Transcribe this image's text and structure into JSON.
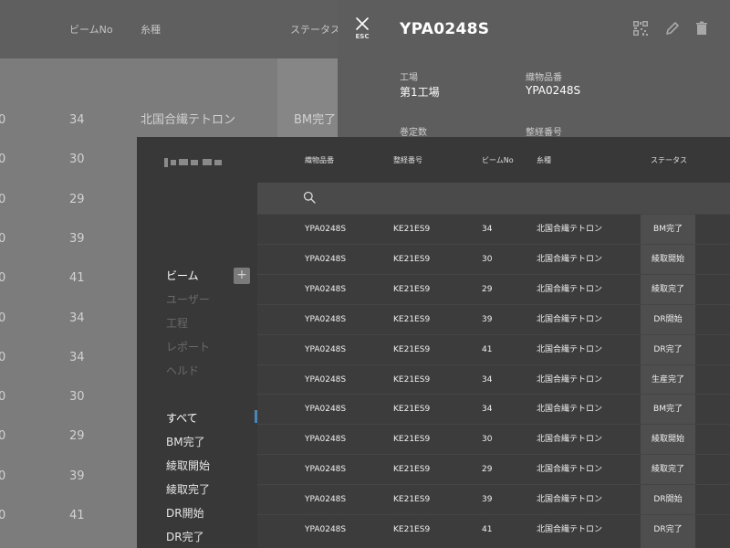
{
  "background_table": {
    "columns": [
      "ビームNo",
      "糸種",
      "ステータス"
    ],
    "rows": [
      {
        "lead": "0",
        "beam": "34",
        "yarn": "北国合繊テトロン",
        "status": "BM完了"
      },
      {
        "lead": "0",
        "beam": "30",
        "yarn": "",
        "status": ""
      },
      {
        "lead": "0",
        "beam": "29",
        "yarn": "",
        "status": ""
      },
      {
        "lead": "0",
        "beam": "39",
        "yarn": "",
        "status": ""
      },
      {
        "lead": "0",
        "beam": "41",
        "yarn": "",
        "status": ""
      },
      {
        "lead": "0",
        "beam": "34",
        "yarn": "",
        "status": ""
      },
      {
        "lead": "0",
        "beam": "34",
        "yarn": "",
        "status": ""
      },
      {
        "lead": "0",
        "beam": "30",
        "yarn": "",
        "status": ""
      },
      {
        "lead": "0",
        "beam": "29",
        "yarn": "",
        "status": ""
      },
      {
        "lead": "0",
        "beam": "39",
        "yarn": "",
        "status": ""
      },
      {
        "lead": "0",
        "beam": "41",
        "yarn": "",
        "status": ""
      }
    ]
  },
  "drawer": {
    "esc_label": "ESC",
    "title": "YPA0248S",
    "tools": [
      "qr-code-icon",
      "pencil-icon",
      "trash-icon"
    ],
    "fields": [
      {
        "label": "工場",
        "value": "第1工場"
      },
      {
        "label": "織物品番",
        "value": "YPA0248S"
      },
      {
        "label": "巻定数",
        "value": ""
      },
      {
        "label": "整経番号",
        "value": ""
      }
    ]
  },
  "sidebar": {
    "nav": [
      {
        "label": "ビーム",
        "enabled": true
      },
      {
        "label": "ユーザー",
        "enabled": false
      },
      {
        "label": "工程",
        "enabled": false
      },
      {
        "label": "レポート",
        "enabled": false
      },
      {
        "label": "ヘルド",
        "enabled": false
      }
    ],
    "add_label": "+",
    "filters": [
      {
        "label": "すべて",
        "active": true
      },
      {
        "label": "BM完了",
        "active": false
      },
      {
        "label": "綾取開始",
        "active": false
      },
      {
        "label": "綾取完了",
        "active": false
      },
      {
        "label": "DR開始",
        "active": false
      },
      {
        "label": "DR完了",
        "active": false
      }
    ]
  },
  "table": {
    "columns": [
      "織物品番",
      "整経番号",
      "ビームNo",
      "糸種",
      "ステータス"
    ],
    "rows": [
      [
        "YPA0248S",
        "KE21ES9",
        "34",
        "北国合繊テトロン",
        "BM完了"
      ],
      [
        "YPA0248S",
        "KE21ES9",
        "30",
        "北国合繊テトロン",
        "綾取開始"
      ],
      [
        "YPA0248S",
        "KE21ES9",
        "29",
        "北国合繊テトロン",
        "綾取完了"
      ],
      [
        "YPA0248S",
        "KE21ES9",
        "39",
        "北国合繊テトロン",
        "DR開始"
      ],
      [
        "YPA0248S",
        "KE21ES9",
        "41",
        "北国合繊テトロン",
        "DR完了"
      ],
      [
        "YPA0248S",
        "KE21ES9",
        "34",
        "北国合繊テトロン",
        "生産完了"
      ],
      [
        "YPA0248S",
        "KE21ES9",
        "34",
        "北国合繊テトロン",
        "BM完了"
      ],
      [
        "YPA0248S",
        "KE21ES9",
        "30",
        "北国合繊テトロン",
        "綾取開始"
      ],
      [
        "YPA0248S",
        "KE21ES9",
        "29",
        "北国合繊テトロン",
        "綾取完了"
      ],
      [
        "YPA0248S",
        "KE21ES9",
        "39",
        "北国合繊テトロン",
        "DR開始"
      ],
      [
        "YPA0248S",
        "KE21ES9",
        "41",
        "北国合繊テトロン",
        "DR完了"
      ]
    ]
  },
  "colors": {
    "accent": "#2b8fde",
    "panel": "#383838",
    "drawer": "#5d5d5d"
  }
}
